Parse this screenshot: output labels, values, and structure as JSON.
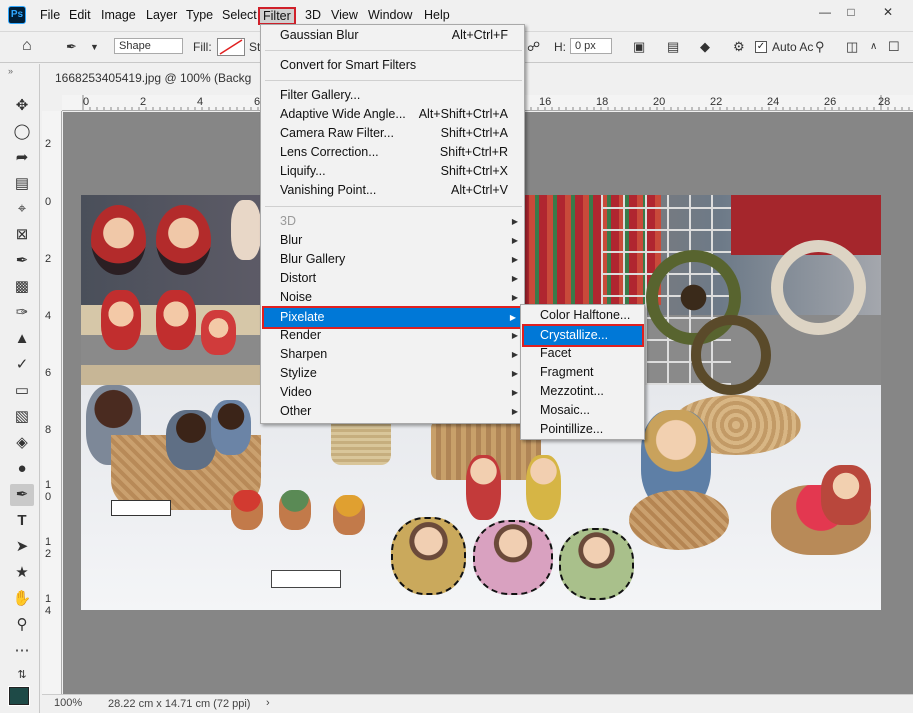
{
  "menubar": {
    "app_icon": "Ps",
    "items": [
      "File",
      "Edit",
      "Image",
      "Layer",
      "Type",
      "Select",
      "Filter",
      "3D",
      "View",
      "Window",
      "Help"
    ],
    "active_item": "Filter"
  },
  "options_bar": {
    "shape_mode": "Shape",
    "fill_label": "Fill:",
    "stroke_label_partial": "St",
    "h_label": "H:",
    "h_value": "0 px",
    "auto_label": "Auto Ac"
  },
  "document": {
    "title": "1668253405419.jpg @ 100% (Backg",
    "ruler_top_ticks": [
      "0",
      "2",
      "4",
      "6",
      "16",
      "18",
      "20",
      "22",
      "24",
      "26",
      "28"
    ],
    "ruler_left_ticks": [
      "2",
      "0",
      "2",
      "4",
      "6",
      "8",
      "1",
      "0",
      "1",
      "2",
      "1",
      "4"
    ]
  },
  "status": {
    "zoom": "100%",
    "size": "28.22 cm x 14.71 cm (72 ppi)"
  },
  "filter_menu": {
    "items": [
      {
        "label": "Gaussian Blur",
        "shortcut": "Alt+Ctrl+F"
      },
      {
        "label": "Convert for Smart Filters"
      },
      {
        "label": "Filter Gallery..."
      },
      {
        "label": "Adaptive Wide Angle...",
        "shortcut": "Alt+Shift+Ctrl+A"
      },
      {
        "label": "Camera Raw Filter...",
        "shortcut": "Shift+Ctrl+A"
      },
      {
        "label": "Lens Correction...",
        "shortcut": "Shift+Ctrl+R"
      },
      {
        "label": "Liquify...",
        "shortcut": "Shift+Ctrl+X"
      },
      {
        "label": "Vanishing Point...",
        "shortcut": "Alt+Ctrl+V"
      },
      {
        "label": "3D",
        "submenu": true,
        "disabled": true
      },
      {
        "label": "Blur",
        "submenu": true
      },
      {
        "label": "Blur Gallery",
        "submenu": true
      },
      {
        "label": "Distort",
        "submenu": true
      },
      {
        "label": "Noise",
        "submenu": true
      },
      {
        "label": "Pixelate",
        "submenu": true,
        "highlighted": true
      },
      {
        "label": "Render",
        "submenu": true
      },
      {
        "label": "Sharpen",
        "submenu": true
      },
      {
        "label": "Stylize",
        "submenu": true
      },
      {
        "label": "Video",
        "submenu": true
      },
      {
        "label": "Other",
        "submenu": true
      }
    ]
  },
  "pixelate_submenu": {
    "items": [
      "Color Halftone...",
      "Crystallize...",
      "Facet",
      "Fragment",
      "Mezzotint...",
      "Mosaic...",
      "Pointillize..."
    ],
    "highlighted": "Crystallize..."
  },
  "colors": {
    "highlight": "#0078d7",
    "annotation_border": "#e02020",
    "foreground_swatch": "#1e4a47",
    "pasteboard": "#868686"
  },
  "tools": [
    "move-icon",
    "marquee-icon",
    "lasso-icon",
    "quick-select-icon",
    "crop-icon",
    "frame-icon",
    "eyedropper-icon",
    "healing-icon",
    "brush-icon",
    "stamp-icon",
    "history-brush-icon",
    "eraser-icon",
    "gradient-icon",
    "blur-icon",
    "dodge-icon",
    "pen-icon",
    "type-icon",
    "path-select-icon",
    "shape-icon",
    "hand-icon",
    "zoom-icon",
    "more-icon"
  ]
}
